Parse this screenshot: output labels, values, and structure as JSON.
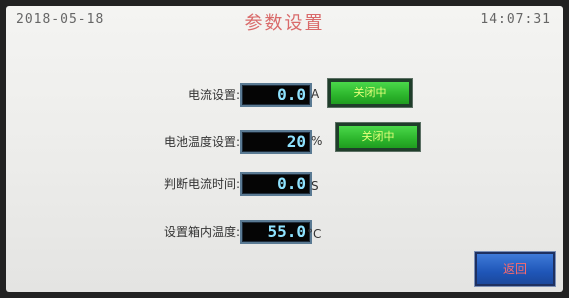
{
  "header": {
    "date": "2018-05-18",
    "title": "参数设置",
    "time": "14:07:31"
  },
  "rows": [
    {
      "label": "电流设置:",
      "value": "0.0",
      "unit": "A",
      "button": "关闭中"
    },
    {
      "label": "电池温度设置:",
      "value": "20",
      "unit": "%",
      "button": "关闭中"
    },
    {
      "label": "判断电流时间:",
      "value": "0.0",
      "unit": "S"
    },
    {
      "label": "设置箱内温度:",
      "value": "55.0",
      "unit": "°C"
    }
  ],
  "footer": {
    "back_label": "返回"
  },
  "colors": {
    "title": "#d96a6a",
    "display_text": "#8fe3ff",
    "green_button": "#2cb52c",
    "blue_button": "#1f56b8",
    "back_text": "#ff6a6a"
  }
}
